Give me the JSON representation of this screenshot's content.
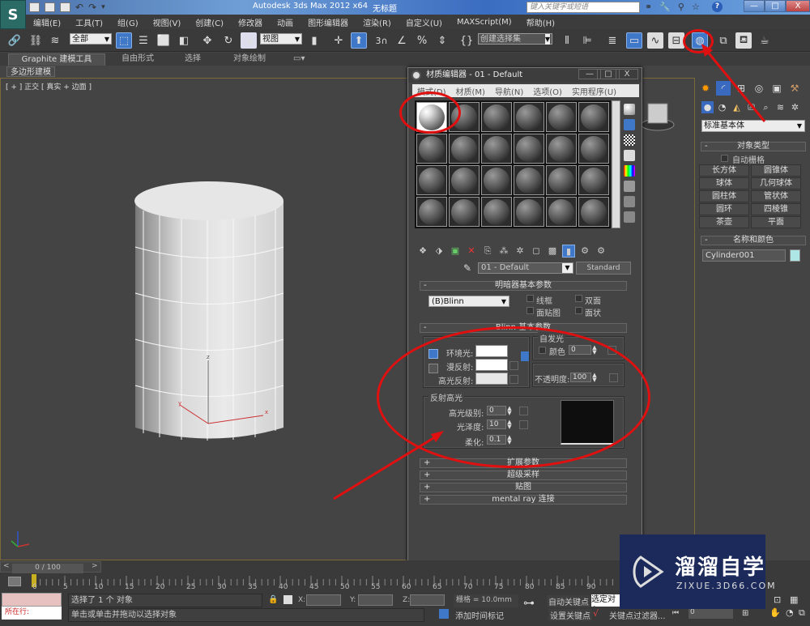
{
  "app": {
    "title": "Autodesk 3ds Max  2012 x64",
    "document": "无标题",
    "logo_icon": "3dsmax-logo-icon",
    "search_placeholder": "键入关键字或短语",
    "quick_access": [
      "new-file-icon",
      "open-file-icon",
      "save-icon",
      "undo-icon",
      "redo-icon",
      "customize-arrow-icon"
    ],
    "info_icons": [
      "binoculars-icon",
      "wrench-icon",
      "satellite-icon",
      "star-icon"
    ],
    "help_label": "?",
    "window_buttons": {
      "minimize": "—",
      "maximize": "□",
      "close": "X"
    }
  },
  "menubar": [
    "编辑(E)",
    "工具(T)",
    "组(G)",
    "视图(V)",
    "创建(C)",
    "修改器",
    "动画",
    "图形编辑器",
    "渲染(R)",
    "自定义(U)",
    "MAXScript(M)",
    "帮助(H)"
  ],
  "toolbar": {
    "selection_filter": "全部",
    "reference_coord": "视图",
    "snap_label": "3",
    "named_selection": "创建选择集"
  },
  "ribbon": {
    "tabs": [
      "Graphite 建模工具",
      "自由形式",
      "选择",
      "对象绘制"
    ],
    "active_tab": "Graphite 建模工具",
    "sub_panel": "多边形建模"
  },
  "viewport": {
    "label": "[ + ] 正交 [ 真实 + 边面 ]",
    "axis": {
      "x": "x",
      "y": "y",
      "z": "z"
    }
  },
  "material_editor": {
    "title": "材质编辑器 - 01 - Default",
    "window_buttons": {
      "minimize": "—",
      "maximize": "□",
      "close": "X"
    },
    "menus": [
      "模式(D)",
      "材质(M)",
      "导航(N)",
      "选项(O)",
      "实用程序(U)"
    ],
    "slots_rows": 4,
    "slots_cols": 6,
    "active_slot": 0,
    "material_name": "01 - Default",
    "material_type": "Standard",
    "shader_rollout": "明暗器基本参数",
    "shader": "(B)Blinn",
    "shader_options": [
      "线框",
      "双面",
      "面贴图",
      "面状"
    ],
    "blinn_rollout": "Blinn 基本参数",
    "self_illum": {
      "group": "自发光",
      "label": "颜色",
      "value": "0"
    },
    "ambient_label": "环境光:",
    "diffuse_label": "漫反射:",
    "specular_label": "高光反射:",
    "opacity": {
      "label": "不透明度:",
      "value": "100"
    },
    "specular_highlights": {
      "group": "反射高光",
      "level_label": "高光级别:",
      "level": "0",
      "gloss_label": "光泽度:",
      "gloss": "10",
      "soften_label": "柔化:",
      "soften": "0.1"
    },
    "collapsed_rollouts": [
      "扩展参数",
      "超级采样",
      "贴图",
      "mental ray 连接"
    ],
    "colors": {
      "ambient": "#ffffff",
      "diffuse": "#ffffff",
      "specular": "#e6e6e6",
      "highlight_preview": "#0e0e0e"
    }
  },
  "command_panel": {
    "tabs": [
      "create-icon",
      "modify-icon",
      "hierarchy-icon",
      "motion-icon",
      "display-icon",
      "utilities-icon"
    ],
    "sub_tabs": [
      "geometry-icon",
      "shapes-icon",
      "lights-icon",
      "cameras-icon",
      "helpers-icon",
      "spacewarps-icon",
      "systems-icon"
    ],
    "category": "标准基本体",
    "object_type_rollout": "对象类型",
    "autogrid": "自动栅格",
    "objects": [
      "长方体",
      "圆锥体",
      "球体",
      "几何球体",
      "圆柱体",
      "管状体",
      "圆环",
      "四棱锥",
      "茶壶",
      "平面"
    ],
    "name_color_rollout": "名称和颜色",
    "object_name": "Cylinder001",
    "object_color": "#aee6e6"
  },
  "timeline": {
    "frame": "0 / 100",
    "prev": "<",
    "next": ">",
    "ticks": [
      "0",
      "5",
      "10",
      "15",
      "20",
      "25",
      "30",
      "35",
      "40",
      "45",
      "50",
      "55",
      "60",
      "65",
      "70",
      "75",
      "80",
      "85",
      "90"
    ]
  },
  "status": {
    "maxscript_label": "所在行:",
    "selected": "选择了 1 个 对象",
    "prompt": "单击或单击并拖动以选择对象",
    "x_label": "X:",
    "y_label": "Y:",
    "z_label": "Z:",
    "grid": "栅格 = 10.0mm",
    "add_time_tag": "添加时间标记",
    "auto_key": "自动关键点",
    "set_key": "设置关键点",
    "selected_object": "选定对象",
    "key_filters": "关键点过滤器...",
    "frame_value": "0"
  },
  "watermark": {
    "brand": "溜溜自学",
    "url": "ZIXUE.3D66.COM",
    "color": "#1b2a5a"
  },
  "annotations": {
    "color": "#e01010"
  }
}
